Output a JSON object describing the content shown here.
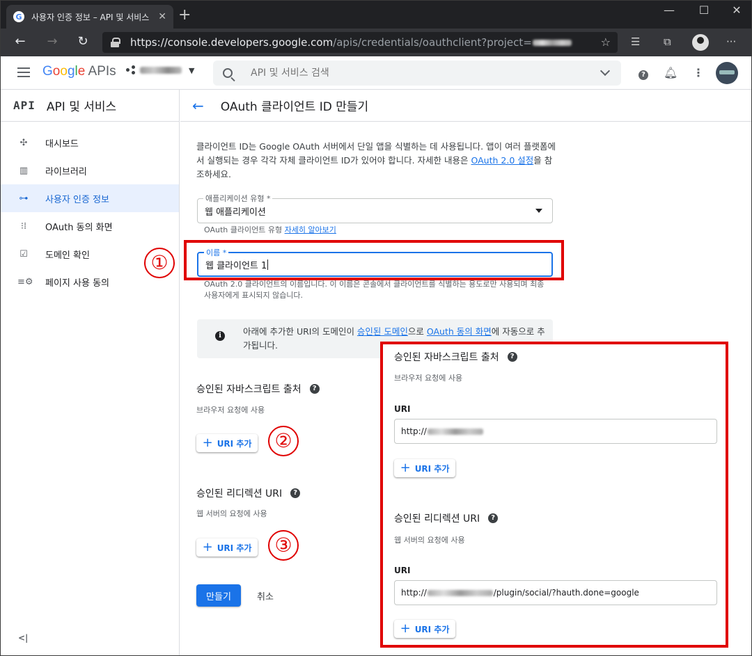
{
  "browser": {
    "tab_title": "사용자 인증 정보 – API 및 서비스",
    "tab_favicon": "G",
    "url_host": "https://console.developers.google.com",
    "url_path": "/apis/credentials/oauthclient?project="
  },
  "header": {
    "logo_google": "Google",
    "logo_apis": " APIs",
    "search_placeholder": "API 및 서비스 검색"
  },
  "sidebar": {
    "badge": "API",
    "title": "API 및 서비스",
    "items": [
      {
        "label": "대시보드",
        "icon": "dashboard-icon"
      },
      {
        "label": "라이브러리",
        "icon": "library-icon"
      },
      {
        "label": "사용자 인증 정보",
        "icon": "key-icon"
      },
      {
        "label": "OAuth 동의 화면",
        "icon": "consent-icon"
      },
      {
        "label": "도메인 확인",
        "icon": "domain-check-icon"
      },
      {
        "label": "페이지 사용 동의",
        "icon": "page-settings-icon"
      }
    ],
    "collapse_label": "<|"
  },
  "page": {
    "title": "OAuth 클라이언트 ID 만들기",
    "desc_1": "클라이언트 ID는 Google OAuth 서버에서 단일 앱을 식별하는 데 사용됩니다. 앱이 여러 플랫폼에서 실행되는 경우 각각 자체 클라이언트 ID가 있어야 합니다. 자세한 내용은 ",
    "desc_link": "OAuth 2.0 설정",
    "desc_2": "을 참조하세요.",
    "app_type_label": "애플리케이션 유형 *",
    "app_type_value": "웹 애플리케이션",
    "app_type_hint": "OAuth 클라이언트 유형 ",
    "app_type_hint_link": "자세히 알아보기",
    "name_label": "이름 *",
    "name_value": "웹 클라이언트 1",
    "name_hint": "OAuth 2.0 클라이언트의 이름입니다. 이 이름은 콘솔에서 클라이언트를 식별하는 용도로만 사용되며 최종 사용자에게 표시되지 않습니다.",
    "notice_1": "아래에 추가한 URI의 도메인이 ",
    "notice_link1": "승인된 도메인",
    "notice_2": "으로 ",
    "notice_link2": "OAuth 동의 화면",
    "notice_3": "에 자동으로 추가됩니다.",
    "js_origins_title": "승인된 자바스크립트 출처",
    "js_origins_sub": "브라우저 요청에 사용",
    "add_uri": "URI 추가",
    "redirect_title": "승인된 리디렉션 URI",
    "redirect_sub": "웹 서버의 요청에 사용",
    "create": "만들기",
    "cancel": "취소"
  },
  "annotations": {
    "n1": "①",
    "n2": "②",
    "n3": "③",
    "color": "#e00000"
  },
  "callout": {
    "js_title": "승인된 자바스크립트 출처",
    "js_sub": "브라우저 요청에 사용",
    "uri_label": "URI",
    "js_uri_prefix": "http://",
    "add_uri": "URI 추가",
    "redirect_title": "승인된 리디렉션 URI",
    "redirect_sub": "웹 서버의 요청에 사용",
    "redirect_uri_prefix": "http://",
    "redirect_uri_suffix": "/plugin/social/?hauth.done=google"
  }
}
